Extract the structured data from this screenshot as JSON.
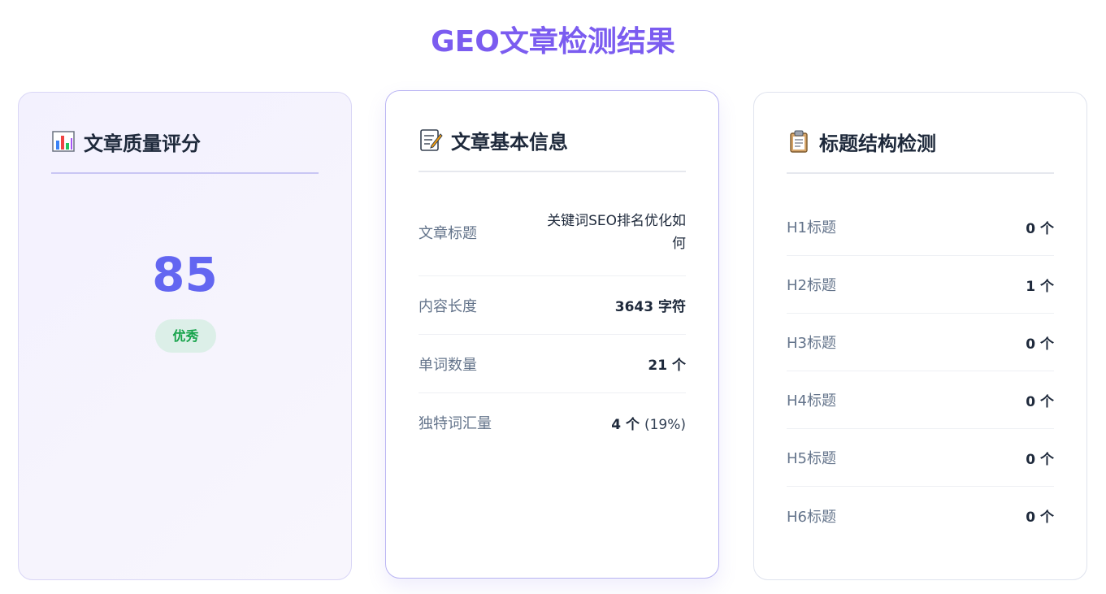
{
  "page": {
    "title": "GEO文章检测结果"
  },
  "score_card": {
    "title": "文章质量评分",
    "icon": "bar-chart-icon",
    "score": "85",
    "badge": "优秀",
    "colors": {
      "score": "#6366f1",
      "badge_text": "#16a34a",
      "badge_bg": "#dcefe8"
    }
  },
  "info_card": {
    "title": "文章基本信息",
    "icon": "memo-icon",
    "rows": [
      {
        "label": "文章标题",
        "value": "关键词SEO排名优化如何"
      },
      {
        "label": "内容长度",
        "value": "3643 字符"
      },
      {
        "label": "单词数量",
        "value": "21 个"
      },
      {
        "label": "独特词汇量",
        "value": "4 个",
        "extra": "(19%)"
      }
    ]
  },
  "heading_card": {
    "title": "标题结构检测",
    "icon": "clipboard-icon",
    "rows": [
      {
        "label": "H1标题",
        "value": "0 个"
      },
      {
        "label": "H2标题",
        "value": "1 个"
      },
      {
        "label": "H3标题",
        "value": "0 个"
      },
      {
        "label": "H4标题",
        "value": "0 个"
      },
      {
        "label": "H5标题",
        "value": "0 个"
      },
      {
        "label": "H6标题",
        "value": "0 个"
      }
    ]
  },
  "accent_color": "#7b5cf0"
}
